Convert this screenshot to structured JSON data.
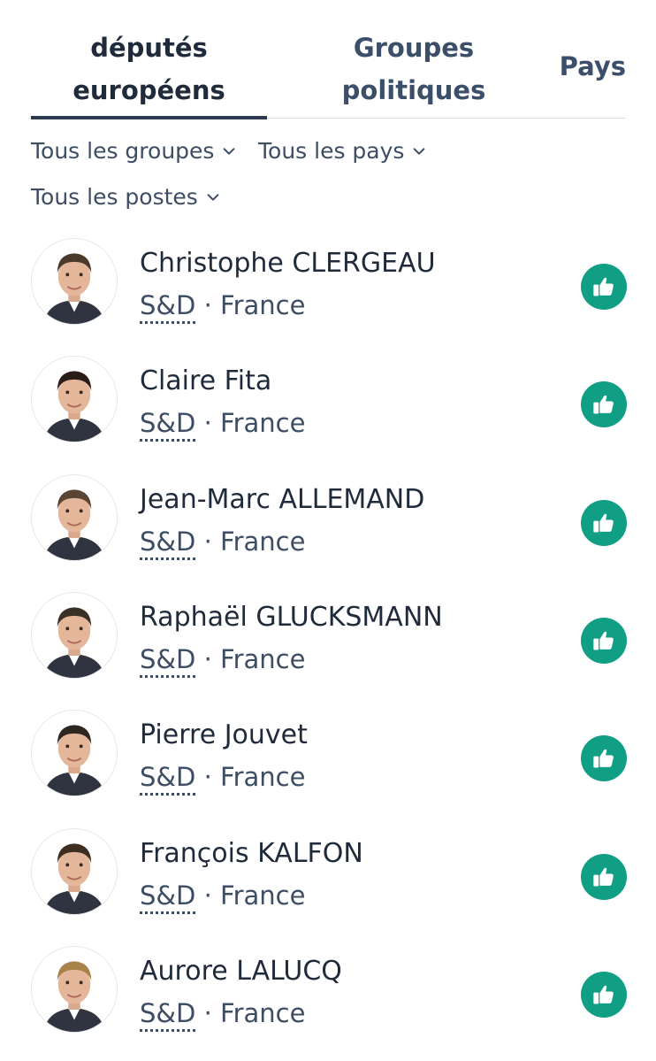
{
  "tabs": {
    "active_line1": "députés",
    "active_line2": "européens",
    "groups_line1": "Groupes",
    "groups_line2": "politiques",
    "countries": "Pays"
  },
  "filters": {
    "groups": "Tous les groupes",
    "countries": "Tous les pays",
    "posts": "Tous les postes"
  },
  "members": [
    {
      "name": "Christophe CLERGEAU",
      "group": "S&D",
      "sep": "·",
      "country": "France",
      "vote_icon": "thumbs-up-icon",
      "hair": "#4a3a2c"
    },
    {
      "name": "Claire Fita",
      "group": "S&D",
      "sep": "·",
      "country": "France",
      "vote_icon": "thumbs-up-icon",
      "hair": "#2a1c16"
    },
    {
      "name": "Jean-Marc ALLEMAND",
      "group": "S&D",
      "sep": "·",
      "country": "France",
      "vote_icon": "thumbs-up-icon",
      "hair": "#5a4434"
    },
    {
      "name": "Raphaël GLUCKSMANN",
      "group": "S&D",
      "sep": "·",
      "country": "France",
      "vote_icon": "thumbs-up-icon",
      "hair": "#3b3026"
    },
    {
      "name": "Pierre Jouvet",
      "group": "S&D",
      "sep": "·",
      "country": "France",
      "vote_icon": "thumbs-up-icon",
      "hair": "#2e2620"
    },
    {
      "name": "François KALFON",
      "group": "S&D",
      "sep": "·",
      "country": "France",
      "vote_icon": "thumbs-up-icon",
      "hair": "#3e2e22"
    },
    {
      "name": "Aurore LALUCQ",
      "group": "S&D",
      "sep": "·",
      "country": "France",
      "vote_icon": "thumbs-up-icon",
      "hair": "#a9824a"
    }
  ],
  "colors": {
    "vote_accent": "#109e85",
    "tab_underline": "#2b3a4e"
  }
}
